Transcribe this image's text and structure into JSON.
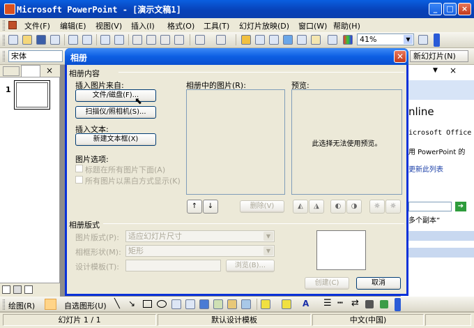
{
  "app": {
    "title": "Microsoft PowerPoint - [演示文稿1]",
    "window_controls": [
      "_",
      "□",
      "×"
    ]
  },
  "menu": [
    "文件(F)",
    "编辑(E)",
    "视图(V)",
    "插入(I)",
    "格式(O)",
    "工具(T)",
    "幻灯片放映(D)",
    "窗口(W)",
    "帮助(H)"
  ],
  "toolbar": {
    "zoom": "41%",
    "font": "宋体",
    "new_slide": "新幻灯片(N)"
  },
  "left_panel": {
    "slide_number": "1"
  },
  "task_pane": {
    "online": "nline",
    "line1": "icrosoft Office",
    "line2": "用 PowerPoint 的",
    "line3": "更新此列表",
    "line4": "多个副本”"
  },
  "drawing_toolbar": {
    "draw": "绘图(R)",
    "autoshapes": "自选图形(U)"
  },
  "status": {
    "slide": "幻灯片 1 / 1",
    "design": "默认设计模板",
    "language": "中文(中国)"
  },
  "dialog": {
    "title": "相册",
    "album_content": "相册内容",
    "insert_from": "插入图片来自:",
    "file_disk": "文件/磁盘(F)...",
    "scanner": "扫描仪/照相机(S)...",
    "insert_text": "插入文本:",
    "new_textbox": "新建文本框(X)",
    "picture_options": "图片选项:",
    "captions_below": "标题在所有图片下面(A)",
    "all_bw": "所有图片以黑白方式显示(K)",
    "pictures_in_album": "相册中的图片(R):",
    "preview_label": "预览:",
    "preview_msg": "此选择无法使用预览。",
    "remove": "删除(V)",
    "album_layout": "相册版式",
    "picture_layout_label": "图片版式(P):",
    "picture_layout_value": "适应幻灯片尺寸",
    "frame_shape_label": "相框形状(M):",
    "frame_shape_value": "矩形",
    "design_template_label": "设计模板(T):",
    "browse": "浏览(B)...",
    "create": "创建(C)",
    "cancel": "取消"
  }
}
